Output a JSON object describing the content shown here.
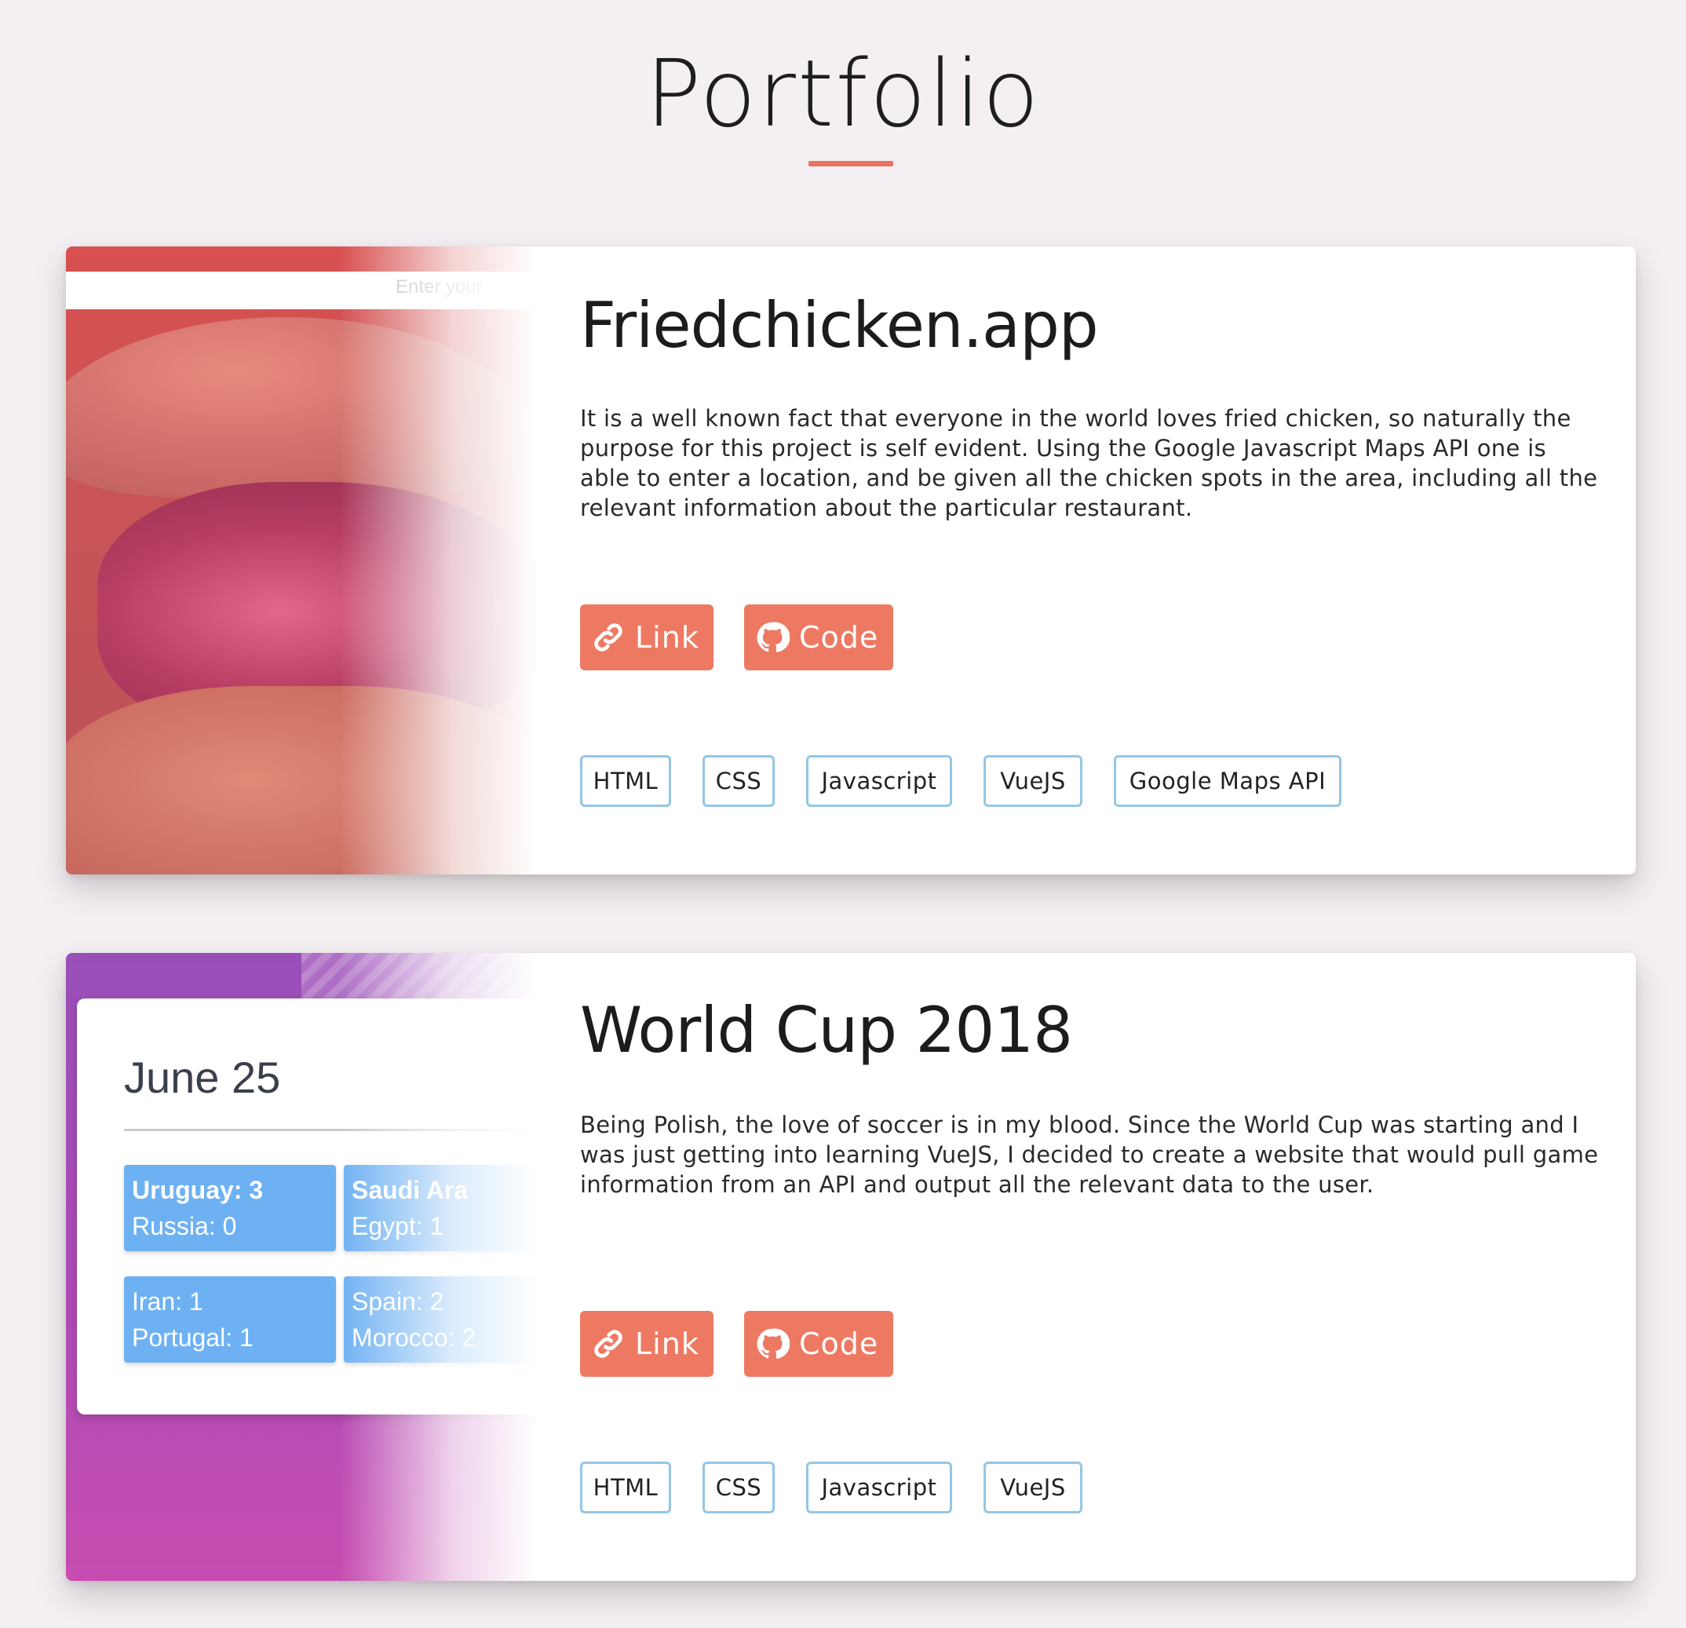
{
  "page": {
    "title": "Portfolio"
  },
  "colors": {
    "accent": "#ee7963",
    "tag_border": "#93c6e6",
    "background": "#f4eff2"
  },
  "projects": [
    {
      "title": "Friedchicken.app",
      "description": "It is a well known fact that everyone in the world loves fried chicken, so naturally the purpose for this project is self evident. Using the Google Javascript Maps API one is able to enter a location, and be given all the chicken spots in the area, including all the relevant information about the particular restaurant.",
      "link_label": "Link",
      "code_label": "Code",
      "link_icon": "link-icon",
      "code_icon": "github-icon",
      "tags": [
        "HTML",
        "CSS",
        "Javascript",
        "VueJS",
        "Google Maps API"
      ],
      "thumbnail": {
        "search_placeholder": "Enter your"
      }
    },
    {
      "title": "World Cup 2018",
      "description": "Being Polish, the love of soccer is in my blood. Since the World Cup was starting and I was just getting into learning VueJS, I decided to create a website that would pull game information from an API and output all the relevant data to the user.",
      "link_label": "Link",
      "code_label": "Code",
      "link_icon": "link-icon",
      "code_icon": "github-icon",
      "tags": [
        "HTML",
        "CSS",
        "Javascript",
        "VueJS"
      ],
      "thumbnail": {
        "date": "June 25",
        "matches": [
          {
            "team1": "Uruguay: 3",
            "team2": "Russia: 0"
          },
          {
            "team1": "Saudi Ara",
            "team2": "Egypt: 1"
          },
          {
            "team1": "Iran: 1",
            "team2": "Portugal: 1"
          },
          {
            "team1": "Spain: 2",
            "team2": "Morocco: 2"
          }
        ]
      }
    }
  ]
}
